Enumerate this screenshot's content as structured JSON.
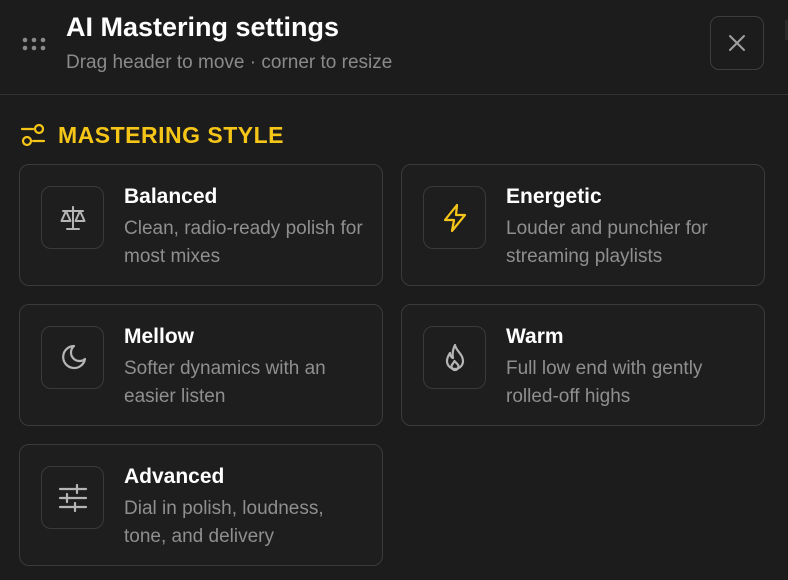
{
  "header": {
    "title": "AI Mastering settings",
    "subtitle": "Drag header to move · corner to resize"
  },
  "section": {
    "title": "MASTERING STYLE"
  },
  "colors": {
    "accent": "#f5c518",
    "background": "#1c1c1c",
    "border": "#3a3a3a",
    "muted_text": "#8f8f8f"
  },
  "styles": [
    {
      "title": "Balanced",
      "description": "Clean, radio-ready polish for most mixes",
      "icon": "scale-icon"
    },
    {
      "title": "Energetic",
      "description": "Louder and punchier for streaming playlists",
      "icon": "lightning-icon"
    },
    {
      "title": "Mellow",
      "description": "Softer dynamics with an easier listen",
      "icon": "moon-icon"
    },
    {
      "title": "Warm",
      "description": "Full low end with gently rolled-off highs",
      "icon": "flame-icon"
    },
    {
      "title": "Advanced",
      "description": "Dial in polish, loudness, tone, and delivery",
      "icon": "sliders-icon"
    }
  ]
}
